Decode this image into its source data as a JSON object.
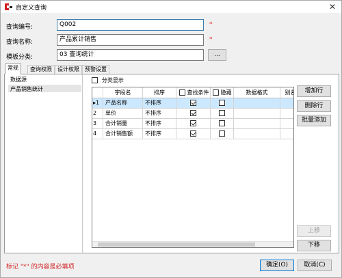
{
  "window": {
    "title": "自定义查询",
    "close_glyph": "✕"
  },
  "form": {
    "code_label": "查询编号:",
    "code_value": "Q002",
    "name_label": "查询名称:",
    "name_value": "产品累计销售",
    "category_label": "模板分类:",
    "category_value": "03 查询统计",
    "browse_label": "...",
    "required_mark": "*"
  },
  "tabs": [
    "常规",
    "查询权限",
    "设计权限",
    "预警设置"
  ],
  "left_list": {
    "items": [
      "数据源",
      "产品销售统计"
    ],
    "selected_index": 1
  },
  "category_display": {
    "label": "分类显示",
    "checked": false
  },
  "grid": {
    "columns": [
      "字段名",
      "排序",
      "查找条件",
      "隐藏",
      "数据格式",
      "别名"
    ],
    "rows": [
      {
        "index": "1",
        "field": "产品名称",
        "sort": "不排序",
        "search": true,
        "hidden": false,
        "format": "",
        "alias": "",
        "current": true
      },
      {
        "index": "2",
        "field": "单价",
        "sort": "不排序",
        "search": true,
        "hidden": false,
        "format": "",
        "alias": "",
        "current": false
      },
      {
        "index": "3",
        "field": "合计销量",
        "sort": "不排序",
        "search": true,
        "hidden": false,
        "format": "",
        "alias": "",
        "current": false
      },
      {
        "index": "4",
        "field": "合计销售额",
        "sort": "不排序",
        "search": true,
        "hidden": false,
        "format": "",
        "alias": "",
        "current": false
      }
    ]
  },
  "side_buttons": {
    "add_row": "增加行",
    "delete_row": "删除行",
    "batch_add": "批量添加",
    "move_up": "上移",
    "move_down": "下移"
  },
  "footer": {
    "note": "标记 \"*\" 的内容是必填项",
    "ok": "确定(O)",
    "cancel": "取消(C)"
  },
  "colors": {
    "required": "#e02020",
    "selection": "#cce8ff",
    "focus_border": "#3c7fb1"
  }
}
